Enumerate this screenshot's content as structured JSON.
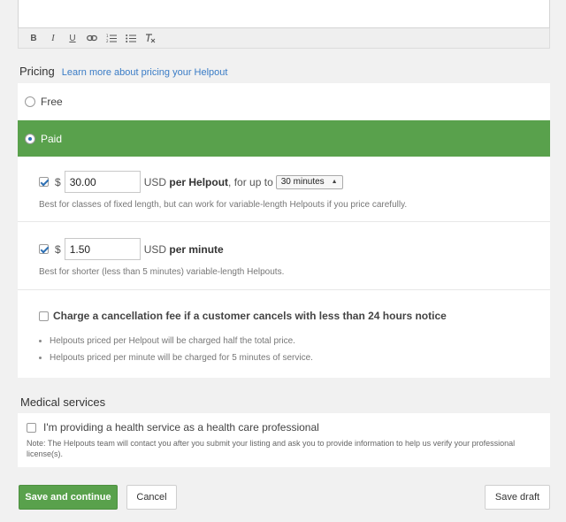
{
  "editor": {
    "toolbar": [
      {
        "name": "bold-button",
        "label": "B",
        "cls": "b"
      },
      {
        "name": "italic-button",
        "label": "I",
        "cls": "i"
      },
      {
        "name": "underline-button",
        "label": "U",
        "cls": "u"
      }
    ],
    "toolbar_icons": [
      "link-icon",
      "numbered-list-icon",
      "bulleted-list-icon",
      "clear-formatting-icon"
    ]
  },
  "pricing": {
    "title": "Pricing",
    "learn_more": "Learn more about pricing your Helpout",
    "free_label": "Free",
    "paid_label": "Paid",
    "selected": "paid",
    "per_helpout": {
      "checked": true,
      "currency_symbol": "$",
      "amount": "30.00",
      "unit_prefix": "USD",
      "unit_bold": "per Helpout",
      "suffix": ", for up to",
      "duration": "30 minutes",
      "hint": "Best for classes of fixed length, but can work for variable-length Helpouts if you price carefully."
    },
    "per_minute": {
      "checked": true,
      "currency_symbol": "$",
      "amount": "1.50",
      "unit_prefix": "USD",
      "unit_bold": "per minute",
      "hint": "Best for shorter (less than 5 minutes) variable-length Helpouts."
    },
    "cancellation": {
      "checked": false,
      "label": "Charge a cancellation fee if a customer cancels with less than 24 hours notice",
      "bullets": [
        "Helpouts priced per Helpout will be charged half the total price.",
        "Helpouts priced per minute will be charged for 5 minutes of service."
      ]
    }
  },
  "medical": {
    "title": "Medical services",
    "checked": false,
    "label": "I'm providing a health service as a health care professional",
    "note": "Note: The Helpouts team will contact you after you submit your listing and ask you to provide information to help us verify your professional license(s)."
  },
  "actions": {
    "save_continue": "Save and continue",
    "cancel": "Cancel",
    "save_draft": "Save draft"
  },
  "colors": {
    "accent_green": "#59a14c",
    "link_blue": "#3a7cc6"
  }
}
